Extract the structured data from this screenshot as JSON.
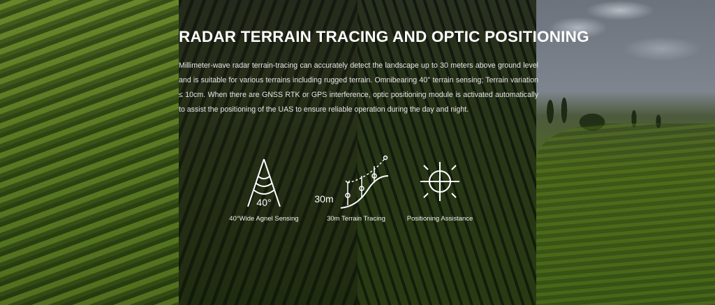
{
  "headline": "RADAR TERRAIN TRACING AND OPTIC POSITIONING",
  "description": "Millimeter-wave radar terrain-tracing can accurately detect the landscape up to 30 meters above ground level and is suitable for various terrains including rugged terrain. Omnibearing 40° terrain sensing; Terrain variation ≤ 10cm. When there are GNSS RTK or GPS interference, optic positioning module is activated automatically to assist the positioning of the UAS to ensure reliable operation during the day and night.",
  "features": [
    {
      "icon": "radar-cone-icon",
      "icon_text": "40°",
      "label": "40°Wide Agnel Sensing"
    },
    {
      "icon": "terrain-tracing-icon",
      "icon_text": "30m",
      "label": "30m Terrain Tracing"
    },
    {
      "icon": "crosshair-sun-icon",
      "label": "Positioning Assistance"
    }
  ],
  "colors": {
    "text": "#ffffff",
    "icon_stroke": "#ffffff"
  }
}
